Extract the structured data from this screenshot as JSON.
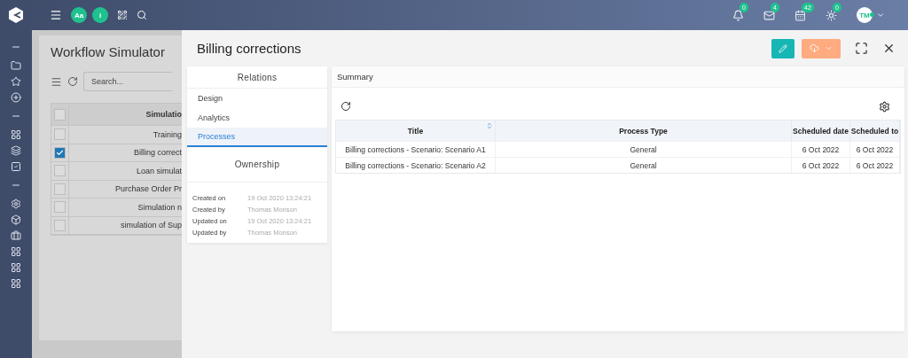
{
  "topbar": {
    "badges": [
      {
        "text": "Aa"
      },
      {
        "text": "i"
      }
    ],
    "notifications": [
      {
        "kind": "bell",
        "count": "0"
      },
      {
        "kind": "mail",
        "count": "4"
      },
      {
        "kind": "calendar",
        "count": "42"
      },
      {
        "kind": "sun",
        "count": "0"
      }
    ],
    "avatar": {
      "initials": "TM",
      "online": true
    }
  },
  "sidebar": {
    "items": [
      {
        "kind": "separator"
      },
      {
        "kind": "folder"
      },
      {
        "kind": "star"
      },
      {
        "kind": "plus"
      },
      {
        "kind": "separator"
      },
      {
        "kind": "grid"
      },
      {
        "kind": "layers"
      },
      {
        "kind": "check"
      },
      {
        "kind": "separator"
      },
      {
        "kind": "settings"
      },
      {
        "kind": "box"
      },
      {
        "kind": "briefcase"
      },
      {
        "kind": "grid"
      },
      {
        "kind": "grid"
      },
      {
        "kind": "grid"
      }
    ]
  },
  "background": {
    "title": "Workflow Simulator",
    "search": {
      "placeholder": "Search..."
    },
    "table": {
      "column_1": "Simulatio",
      "all_checked": false,
      "rows": [
        {
          "text": "Training",
          "checked": false
        },
        {
          "text": "Billing correct",
          "checked": true
        },
        {
          "text": "Loan simulat",
          "checked": false
        },
        {
          "text": "Purchase Order Pr",
          "checked": false
        },
        {
          "text": "Simulation n",
          "checked": false
        },
        {
          "text": "simulation of Sup",
          "checked": false
        }
      ]
    }
  },
  "drawer": {
    "title": "Billing corrections",
    "relations": {
      "title": "Relations",
      "items": [
        {
          "label": "Design",
          "selected": false
        },
        {
          "label": "Analytics",
          "selected": false
        },
        {
          "label": "Processes",
          "selected": true
        }
      ]
    },
    "ownership": {
      "title": "Ownership",
      "fields": [
        {
          "label": "Created on",
          "value": "19 Oct 2020 13:24:21"
        },
        {
          "label": "Created by",
          "value": "Thomas Monson"
        },
        {
          "label": "Updated on",
          "value": "19 Oct 2020 13:24:21"
        },
        {
          "label": "Updated by",
          "value": "Thomas Monson"
        }
      ]
    },
    "summary": {
      "title": "Summary",
      "table": {
        "columns": [
          {
            "label": "Title",
            "sortable": true
          },
          {
            "label": "Process Type",
            "sortable": false
          },
          {
            "label": "Scheduled date",
            "sortable": false
          },
          {
            "label": "Scheduled to",
            "sortable": false
          }
        ],
        "rows": [
          [
            "Billing corrections - Scenario: Scenario A1",
            "General",
            "6 Oct 2022",
            "6 Oct 2022"
          ],
          [
            "Billing corrections - Scenario: Scenario A2",
            "General",
            "6 Oct 2022",
            "6 Oct 2022"
          ]
        ]
      }
    }
  }
}
